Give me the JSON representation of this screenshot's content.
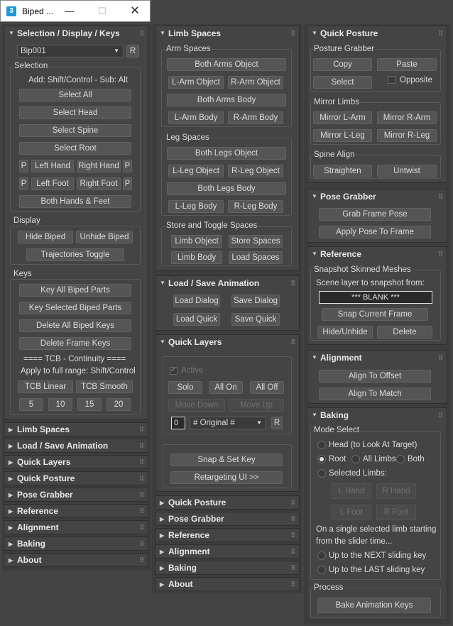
{
  "window": {
    "title": "Biped ...",
    "icon": "3",
    "min": "—",
    "max": "☐",
    "close": "✕"
  },
  "col1": {
    "sel_panel": {
      "title": "Selection / Display / Keys",
      "biped_select": "Bip001",
      "r_label": "R",
      "selection_group": "Selection",
      "hint": "Add: Shift/Control - Sub: Alt",
      "select_all": "Select All",
      "select_head": "Select Head",
      "select_spine": "Select Spine",
      "select_root": "Select Root",
      "p": "P",
      "left_hand": "Left Hand",
      "right_hand": "Right Hand",
      "left_foot": "Left Foot",
      "right_foot": "Right Foot",
      "both_hands_feet": "Both Hands & Feet",
      "display_group": "Display",
      "hide_biped": "Hide Biped",
      "unhide_biped": "Unhide Biped",
      "traj_toggle": "Trajectories Toggle",
      "keys_group": "Keys",
      "key_all": "Key All Biped Parts",
      "key_selected": "Key Selected Biped Parts",
      "delete_all": "Delete All Biped Keys",
      "delete_frame": "Delete Frame Keys",
      "tcb_header": "==== TCB - Continuity ====",
      "apply_range": "Apply to full range: Shift/Control",
      "tcb_linear": "TCB Linear",
      "tcb_smooth": "TCB Smooth",
      "tcb_values": [
        "5",
        "10",
        "15",
        "20"
      ]
    },
    "rollups": [
      "Limb Spaces",
      "Load / Save Animation",
      "Quick Layers",
      "Quick Posture",
      "Pose Grabber",
      "Reference",
      "Alignment",
      "Baking",
      "About"
    ]
  },
  "col2": {
    "limb_panel": {
      "title": "Limb Spaces",
      "arm_group": "Arm Spaces",
      "both_arms_object": "Both Arms Object",
      "l_arm_object": "L-Arm Object",
      "r_arm_object": "R-Arm Object",
      "both_arms_body": "Both Arms Body",
      "l_arm_body": "L-Arm Body",
      "r_arm_body": "R-Arm Body",
      "leg_group": "Leg Spaces",
      "both_legs_object": "Both Legs Object",
      "l_leg_object": "L-Leg Object",
      "r_leg_object": "R-Leg Object",
      "both_legs_body": "Both Legs Body",
      "l_leg_body": "L-Leg Body",
      "r_leg_body": "R-Leg Body",
      "store_group": "Store and Toggle Spaces",
      "limb_object": "Limb Object",
      "store_spaces": "Store Spaces",
      "limb_body": "Limb Body",
      "load_spaces": "Load Spaces"
    },
    "load_panel": {
      "title": "Load / Save Animation",
      "load_dialog": "Load Dialog",
      "save_dialog": "Save Dialog",
      "load_quick": "Load Quick",
      "save_quick": "Save Quick"
    },
    "layers_panel": {
      "title": "Quick Layers",
      "active": "Active",
      "solo": "Solo",
      "all_on": "All On",
      "all_off": "All Off",
      "move_down": "Move Down",
      "move_up": "Move Up",
      "layer_index": "0",
      "layer_name": "# Original #",
      "r_label": "R",
      "snap_set_key": "Snap & Set Key",
      "retargeting": "Retargeting UI  >>"
    },
    "rollups": [
      "Quick Posture",
      "Pose Grabber",
      "Reference",
      "Alignment",
      "Baking",
      "About"
    ]
  },
  "col3": {
    "posture_panel": {
      "title": "Quick Posture",
      "grabber_group": "Posture Grabber",
      "copy": "Copy",
      "paste": "Paste",
      "select": "Select",
      "opposite": "Opposite",
      "mirror_group": "Mirror Limbs",
      "mirror_l_arm": "Mirror L-Arm",
      "mirror_r_arm": "Mirror R-Arm",
      "mirror_l_leg": "Mirror L-Leg",
      "mirror_r_leg": "Mirror R-Leg",
      "spine_group": "Spine Align",
      "straighten": "Straighten",
      "untwist": "Untwist"
    },
    "pose_panel": {
      "title": "Pose Grabber",
      "grab_frame": "Grab Frame Pose",
      "apply_pose": "Apply Pose To Frame"
    },
    "ref_panel": {
      "title": "Reference",
      "snapshot_group": "Snapshot Skinned Meshes",
      "scene_layer": "Scene layer to snapshot from:",
      "blank": "*** BLANK ***",
      "snap_current": "Snap Current Frame",
      "hide_unhide": "Hide/Unhide",
      "delete": "Delete"
    },
    "align_panel": {
      "title": "Alignment",
      "align_offset": "Align To Offset",
      "align_match": "Align To Match"
    },
    "bake_panel": {
      "title": "Baking",
      "mode_group": "Mode Select",
      "head_look": "Head (to Look At Target)",
      "root": "Root",
      "all_limbs": "All Limbs",
      "both": "Both",
      "selected_limbs": "Selected Limbs:",
      "l_hand": "L Hand",
      "r_hand": "R Hand",
      "l_foot": "L Foot",
      "r_foot": "R Foot",
      "desc1": "On a single selected limb starting",
      "desc2": "from the slider time...",
      "up_next": "Up to the NEXT sliding key",
      "up_last": "Up to the LAST sliding key",
      "process_group": "Process",
      "bake_keys": "Bake Animation Keys"
    }
  },
  "icons": {
    "expanded": "▼",
    "collapsed": "▶",
    "grip": "⠿",
    "dropdown": "▼",
    "check": "✔"
  }
}
